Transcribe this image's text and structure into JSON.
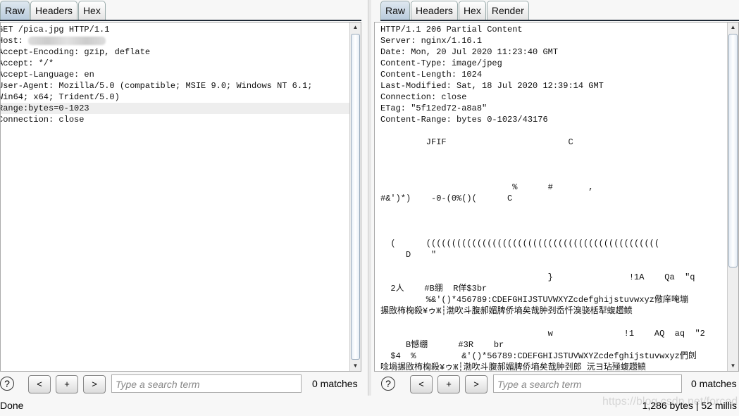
{
  "request": {
    "tabs": [
      "Raw",
      "Headers",
      "Hex"
    ],
    "active_tab": "Raw",
    "lines": [
      "GET /pica.jpg HTTP/1.1",
      "Host: ",
      "Accept-Encoding: gzip, deflate",
      "Accept: */*",
      "Accept-Language: en",
      "User-Agent: Mozilla/5.0 (compatible; MSIE 9.0; Windows NT 6.1;",
      "Win64; x64; Trident/5.0)",
      "Range:bytes=0-1023",
      "Connection: close"
    ],
    "search_placeholder": "Type a search term",
    "matches": "0 matches"
  },
  "response": {
    "tabs": [
      "Raw",
      "Headers",
      "Hex",
      "Render"
    ],
    "active_tab": "Raw",
    "lines": [
      "HTTP/1.1 206 Partial Content",
      "Server: nginx/1.16.1",
      "Date: Mon, 20 Jul 2020 11:23:40 GMT",
      "Content-Type: image/jpeg",
      "Content-Length: 1024",
      "Last-Modified: Sat, 18 Jul 2020 12:39:14 GMT",
      "Connection: close",
      "ETag: \"5f12ed72-a8a8\"",
      "Content-Range: bytes 0-1023/43176",
      "",
      "         JFIF                        C",
      "",
      "",
      "",
      "                          %      #       ,",
      "#&')*)    -0-(0%()(      C",
      "",
      "",
      "",
      "  (      ((((((((((((((((((((((((((((((((((((((((((((((",
      "     D    \"",
      "",
      "                                 }               !1A    Qa  \"q",
      "  2人    #B绷  R佯$3br",
      "         %&'()*456789:CDEFGHIJSTUVWXYZcdefghijstuvwxyz儆庠唵塴",
      "搌敃柨椈殺¥ゥЖ┆渤吹斗腹郝媚脾侨墒矣哉肿刭岙忏溴骁栝犁蝮趱鲼",
      "",
      "                                 w              !1    AQ  aq  \"2",
      "     B憾绷      #3R    br",
      "  $4  %         &'()*56789:CDEFGHIJSTUVWXYZcdefghijstuvwxyz們剆",
      "唸堝搌敃柨椈殺¥ゥЖ┆渤吹斗腹郝媚脾侨墒矣哉肿刭郎 沅ヨ玷殛蝮趱鲼"
    ],
    "search_placeholder": "Type a search term",
    "matches": "0 matches"
  },
  "buttons": {
    "prev": "<",
    "add": "+",
    "next": ">",
    "help": "?"
  },
  "status": {
    "left": "Done",
    "right": "1,286 bytes | 52 millis"
  },
  "watermark": "https://blog.csdn.net/forced"
}
